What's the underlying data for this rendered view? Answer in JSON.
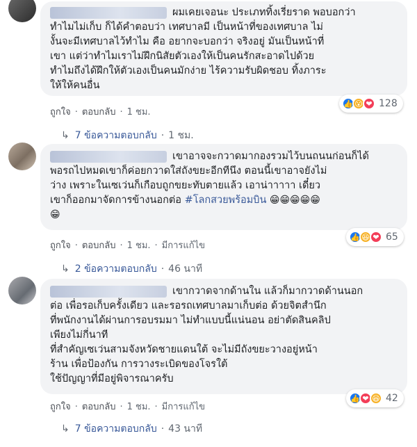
{
  "comments": [
    {
      "name_blurred": true,
      "text": "ผมเคยเจอนะ ประเภททิ้งเรี่ยราด พอบอกว่า\nทำไมไม่เก็บ ก็ได้คำตอบว่า เทศบาลมี เป็นหน้าที่ของเทศบาล ไม่\nงั้นจะมีเทศบาลไว้ทำไม คือ อยากจะบอกว่า จริงอยู่ มันเป็นหน้าที่\nเขา แต่ว่าทำไมเราไม่ฝึกนิสัยตัวเองให้เป็นคนรักสะอาดไปด้วย\nทำไมถึงได้ฝึกให้ตัวเองเป็นคนมักง่าย ไร้ความรับผิดชอบ ทิ้งภาระ\nให้ให้คนอื่น",
      "reactions": [
        "like",
        "wow",
        "love"
      ],
      "reaction_count": "128",
      "like_label": "ถูกใจ",
      "reply_label": "ตอบกลับ",
      "time": "1 ชม.",
      "edited_label": "",
      "replies_label": "7 ข้อความตอบกลับ",
      "replies_time": "1 ชม."
    },
    {
      "name_blurred": true,
      "text_before": "เขาอาจจะกวาดมากองรวมไว้บนถนนก่อนก็ได้\nพอรถไปหมดเขาก็ค่อยกวาดใส่ถังขยะอีกทีนึง ตอนนี้เขาอาจยังไม่\nว่าง เพราะในเซเว่นก็เกือบถูกขยะทับตายแล้ว เอาน่าาาาา เดี๋ยว\nเขาก็ออกมาจัดการข้างนอกต่อ ",
      "hashtag": "#โลกสวยพร้อมบิน",
      "emoji_tail": " 😁😁😁😁😁\n😁",
      "reactions": [
        "like",
        "haha",
        "love"
      ],
      "reaction_count": "65",
      "like_label": "ถูกใจ",
      "reply_label": "ตอบกลับ",
      "time": "1 ชม.",
      "edited_label": "มีการแก้ไข",
      "replies_label": "2 ข้อความตอบกลับ",
      "replies_time": "46 นาที"
    },
    {
      "name_blurred": true,
      "text": "เขากวาดจากด้านใน แล้วก็มากวาดด้านนอก\nต่อ เพื่อรอเก็บครั้งเดียว และรอรถเทศบาลมาเก็บต่อ ด้วยจิตสำนึก\nที่พนักงานได้ผ่านการอบรมมา ไม่ทำแบบนี้แน่นอน อย่าตัดสินคลิป\nเพียงไม่กี่นาที\nที่สำคัญเซเว่นสามจังหวัดชายแดนใต้ จะไม่มีถังขยะวางอยู่หน้า\nร้าน เพื่อป้องกัน การวางระเบิดของโจรใต้\nใช้ปัญญาที่มีอยู่พิจารณาครับ",
      "reactions": [
        "like",
        "love",
        "haha"
      ],
      "reaction_count": "42",
      "like_label": "ถูกใจ",
      "reply_label": "ตอบกลับ",
      "time": "1 ชม.",
      "edited_label": "มีการแก้ไข",
      "replies_label": "7 ข้อความตอบกลับ",
      "replies_time": "43 นาที"
    }
  ],
  "icons": {
    "like": "👍",
    "love": "❤",
    "wow": "😮",
    "haha": "😆"
  },
  "separator": "·",
  "reply_arrow": "↳"
}
